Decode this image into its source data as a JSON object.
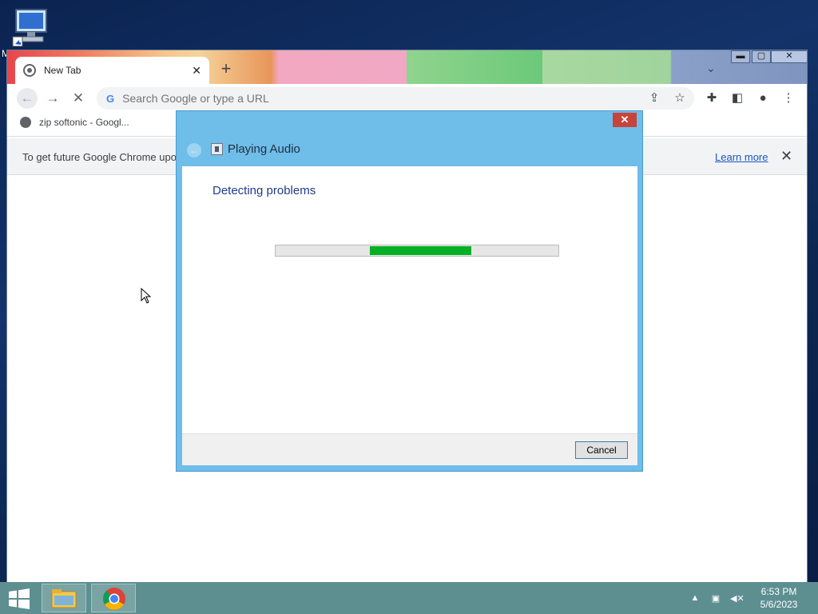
{
  "desktop": {
    "icon_label": "M"
  },
  "browser": {
    "tab_title": "New Tab",
    "tab_close": "✕",
    "new_tab": "+",
    "omnibox_placeholder": "Search Google or type a URL",
    "omnibox_g": "G",
    "bookmark_label": "zip softonic - Googl...",
    "infobar_message": "To get future Google Chrome upo",
    "infobar_link": "Learn more",
    "infobar_close": "✕"
  },
  "dialog": {
    "title": "Playing Audio",
    "heading": "Detecting problems",
    "progress": {
      "start_percent": 33.4,
      "end_percent": 69.1,
      "color": "#06b025"
    },
    "cancel_label": "Cancel",
    "close_label": "✕"
  },
  "taskbar": {
    "time": "6:53 PM",
    "date": "5/6/2023",
    "apps": [
      "file-explorer",
      "google-chrome"
    ]
  }
}
